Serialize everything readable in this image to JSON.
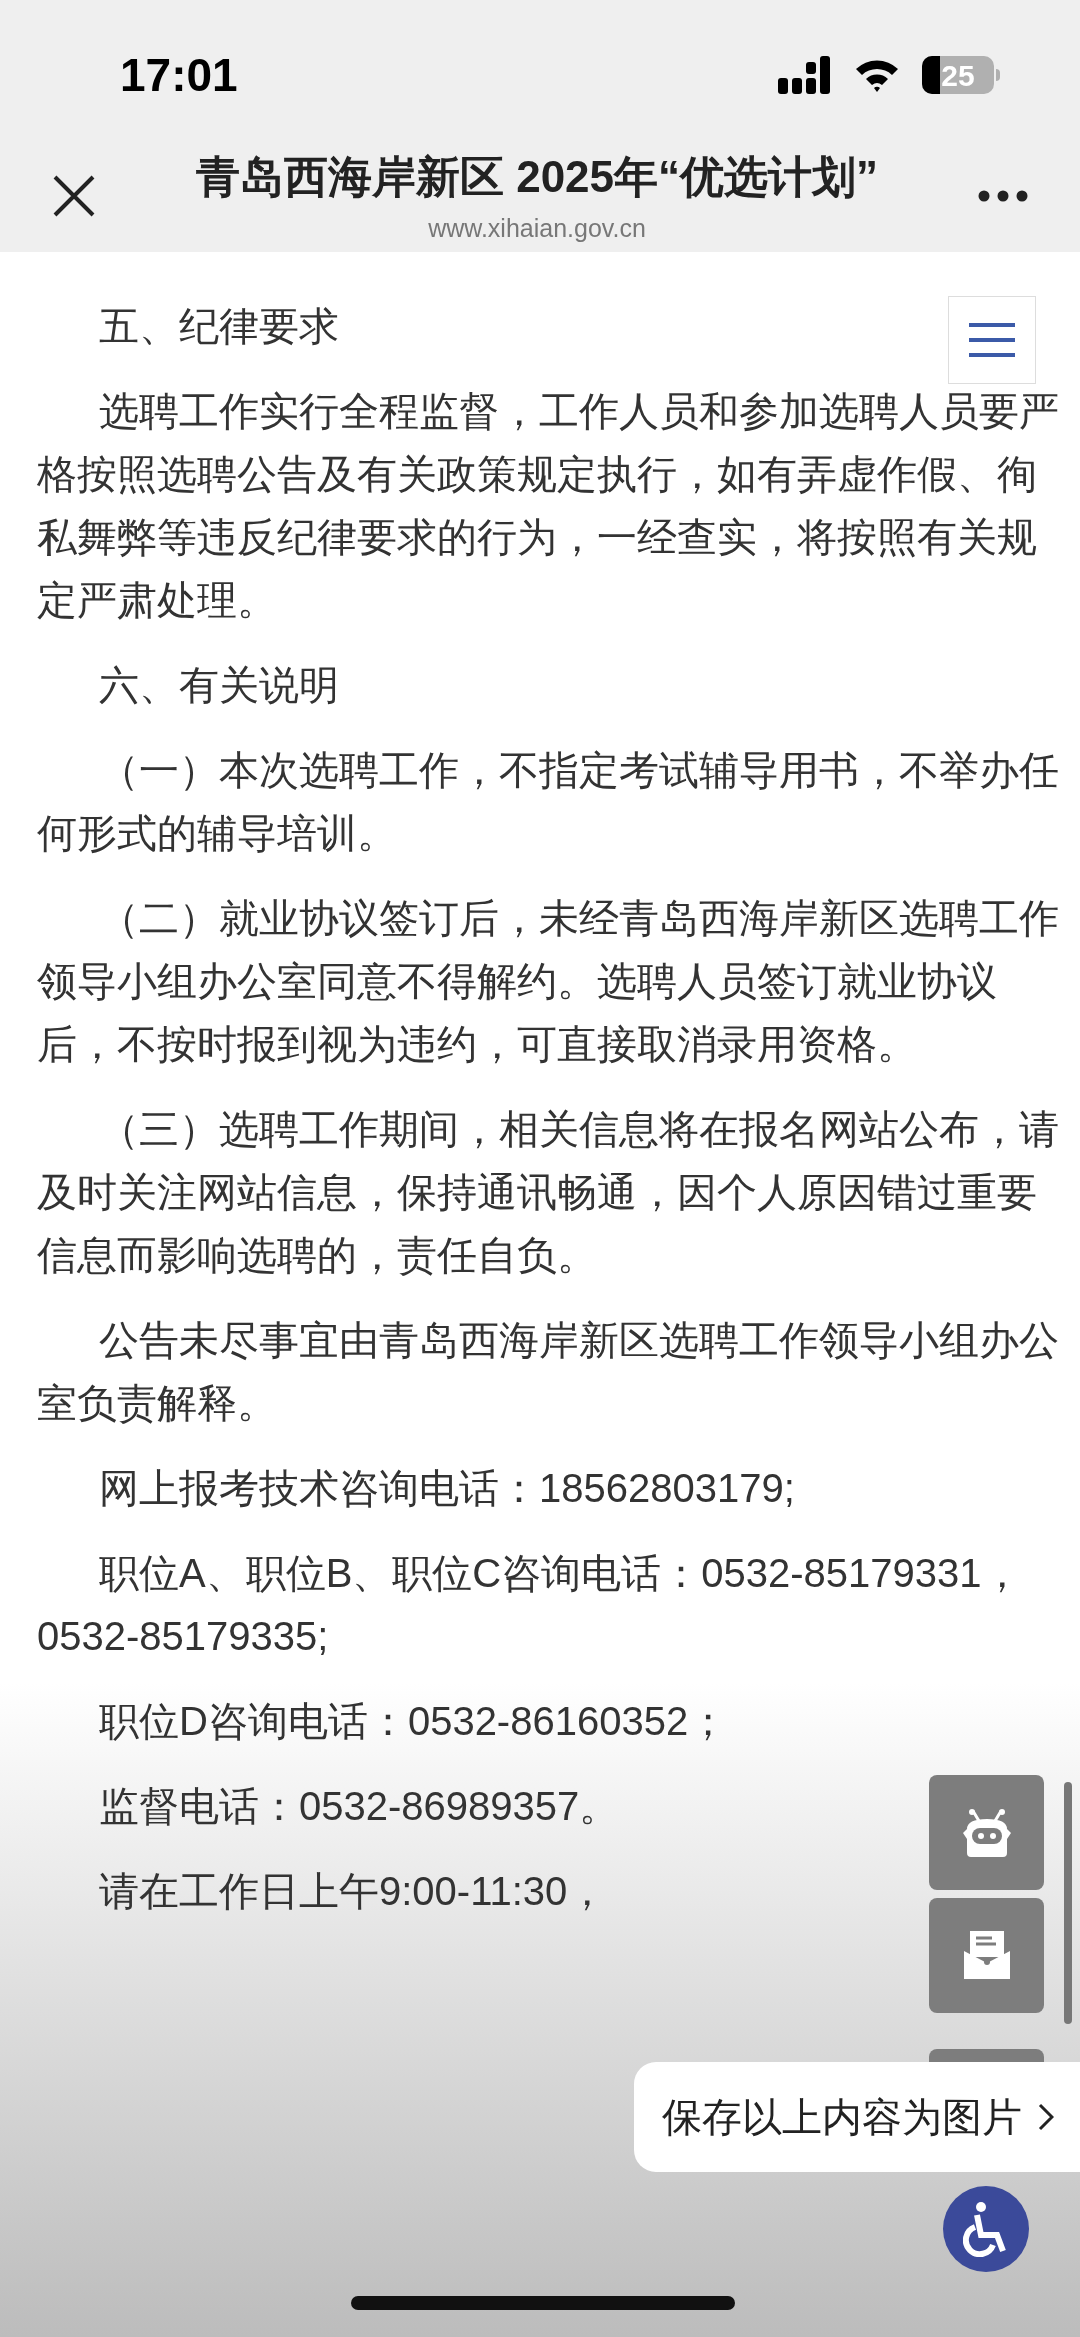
{
  "status_bar": {
    "time": "17:01",
    "battery": "25"
  },
  "header": {
    "title": "青岛西海岸新区 2025年“优选计划”",
    "url": "www.xihaian.gov.cn"
  },
  "article": {
    "paragraphs": [
      {
        "kind": "heading",
        "text": "五、纪律要求"
      },
      {
        "kind": "body",
        "text": "选聘工作实行全程监督，工作人员和参加选聘人员要严格按照选聘公告及有关政策规定执行，如有弄虚作假、徇私舞弊等违反纪律要求的行为，一经查实，将按照有关规定严肃处理。"
      },
      {
        "kind": "heading",
        "text": "六、有关说明"
      },
      {
        "kind": "body",
        "text": "（一）本次选聘工作，不指定考试辅导用书，不举办任何形式的辅导培训。"
      },
      {
        "kind": "body",
        "text": "（二）就业协议签订后，未经青岛西海岸新区选聘工作领导小组办公室同意不得解约。选聘人员签订就业协议后，不按时报到视为违约，可直接取消录用资格。"
      },
      {
        "kind": "body",
        "text": "（三）选聘工作期间，相关信息将在报名网站公布，请及时关注网站信息，保持通讯畅通，因个人原因错过重要信息而影响选聘的，责任自负。"
      },
      {
        "kind": "body",
        "text": "公告未尽事宜由青岛西海岸新区选聘工作领导小组办公室负责解释。"
      },
      {
        "kind": "body",
        "text": "网上报考技术咨询电话：18562803179;"
      },
      {
        "kind": "body",
        "text": "职位A、职位B、职位C咨询电话：0532-85179331，0532-85179335;"
      },
      {
        "kind": "body",
        "text": "职位D咨询电话：0532-86160352；"
      },
      {
        "kind": "body",
        "text": "监督电话：0532-86989357。"
      },
      {
        "kind": "body",
        "text": "请在工作日上午9:00-11:30，"
      }
    ]
  },
  "save_popup": {
    "label": "保存以上内容为图片"
  }
}
